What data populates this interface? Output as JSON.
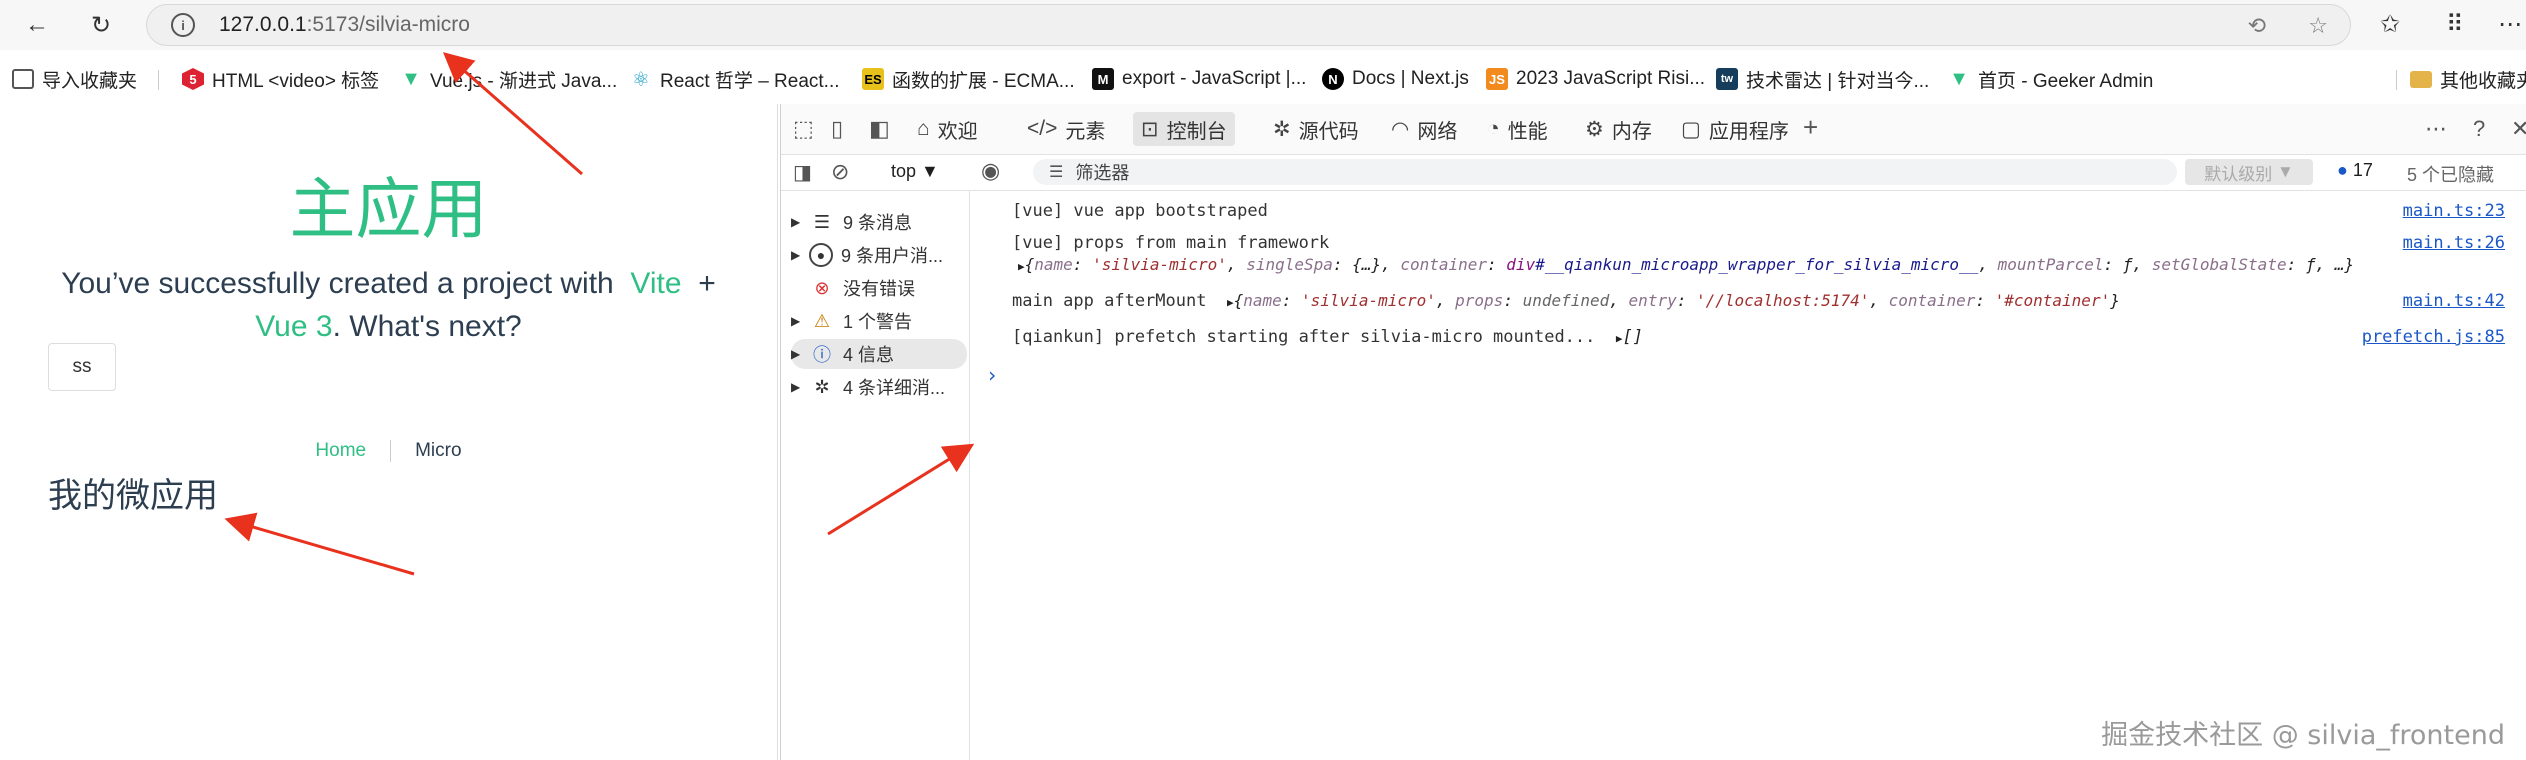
{
  "browser": {
    "url_host": "127.0.0.1",
    "url_rest": ":5173/silvia-micro",
    "nav_icons": [
      "back-icon",
      "reload-icon"
    ],
    "right_icons": [
      "translate-icon",
      "favorite-star-icon",
      "favorites-icon",
      "more-menu-icon"
    ]
  },
  "bookmarks": [
    {
      "label": "导入收藏夹",
      "icon": "folder-import-icon",
      "icon_color": "#555"
    },
    {
      "label": "HTML <video> 标签",
      "icon": "w3school-icon",
      "icon_color": "#d23"
    },
    {
      "label": "Vue.js - 渐进式 Java...",
      "icon": "vue-icon",
      "icon_color": "#2fbf84"
    },
    {
      "label": "React 哲学 – React...",
      "icon": "react-icon",
      "icon_color": "#149eca"
    },
    {
      "label": "函数的扩展 - ECMA...",
      "icon": "es-icon",
      "icon_color": "#e8c21a"
    },
    {
      "label": "export - JavaScript |...",
      "icon": "mdn-icon",
      "icon_color": "#111"
    },
    {
      "label": "Docs | Next.js",
      "icon": "next-icon",
      "icon_color": "#000"
    },
    {
      "label": "2023 JavaScript Risi...",
      "icon": "js-rising-icon",
      "icon_color": "#f28a1e"
    },
    {
      "label": "技术雷达 | 针对当今...",
      "icon": "tw-icon",
      "icon_color": "#163d5c"
    },
    {
      "label": "首页 - Geeker Admin",
      "icon": "vue-icon",
      "icon_color": "#2fbf84"
    },
    {
      "label": "其他收藏夹",
      "icon": "folder-icon",
      "icon_color": "#e4b34a"
    }
  ],
  "app": {
    "title": "主应用",
    "subtitle_before": "You’ve successfully created a project with",
    "vite": "Vite",
    "plus": "+",
    "vue3": "Vue 3",
    "subtitle_after": ". What's next?",
    "button": "ss",
    "nav_home": "Home",
    "nav_micro": "Micro",
    "micro_heading": "我的微应用"
  },
  "devtools": {
    "tabs": [
      {
        "label": "欢迎",
        "icon": "home-icon"
      },
      {
        "label": "元素",
        "icon": "code-icon"
      },
      {
        "label": "控制台",
        "icon": "console-icon",
        "active": true
      },
      {
        "label": "源代码",
        "icon": "bug-icon"
      },
      {
        "label": "网络",
        "icon": "wifi-icon"
      },
      {
        "label": "性能",
        "icon": "gauge-icon"
      },
      {
        "label": "内存",
        "icon": "memory-icon"
      },
      {
        "label": "应用程序",
        "icon": "app-icon"
      }
    ],
    "context": "top",
    "filter_placeholder": "筛选器",
    "levels": "默认级别",
    "issue_count": "17",
    "hidden_count": "5 个已隐藏",
    "sidebar": [
      {
        "label": "9 条消息",
        "icon": "list-icon"
      },
      {
        "label": "9 条用户消...",
        "icon": "user-icon"
      },
      {
        "label": "没有错误",
        "icon": "error-icon"
      },
      {
        "label": "1 个警告",
        "icon": "warning-icon"
      },
      {
        "label": "4 信息",
        "icon": "info-icon",
        "selected": true
      },
      {
        "label": "4 条详细消...",
        "icon": "bug-icon"
      }
    ],
    "console": [
      {
        "text": "[vue] vue app bootstraped",
        "source": "main.ts:23"
      },
      {
        "text": "[vue] props from main framework",
        "source": "main.ts:26"
      },
      {
        "text": "main app afterMount",
        "source": "main.ts:42"
      },
      {
        "text": "[qiankun] prefetch starting after silvia-micro mounted...",
        "source": "prefetch.js:85"
      }
    ],
    "props_obj": {
      "k1": "name",
      "v1": "'silvia-micro'",
      "k2": "singleSpa",
      "v2": "{…}",
      "k3": "container",
      "v3a": "div",
      "v3b": "#__qiankun_microapp_wrapper_for_silvia_micro__",
      "k4": "mountParcel",
      "v4": "ƒ",
      "k5": "setGlobalState",
      "v5": "ƒ",
      "tail": "…}"
    },
    "mount_obj": {
      "k1": "name",
      "v1": "'silvia-micro'",
      "k2": "props",
      "v2": "undefined",
      "k3": "entry",
      "v3": "'//localhost:5174'",
      "k4": "container",
      "v4": "'#container'"
    },
    "empty_array": "[]"
  },
  "watermark": "掘金技术社区 @ silvia_frontend",
  "annotation_color": "#e8321e"
}
